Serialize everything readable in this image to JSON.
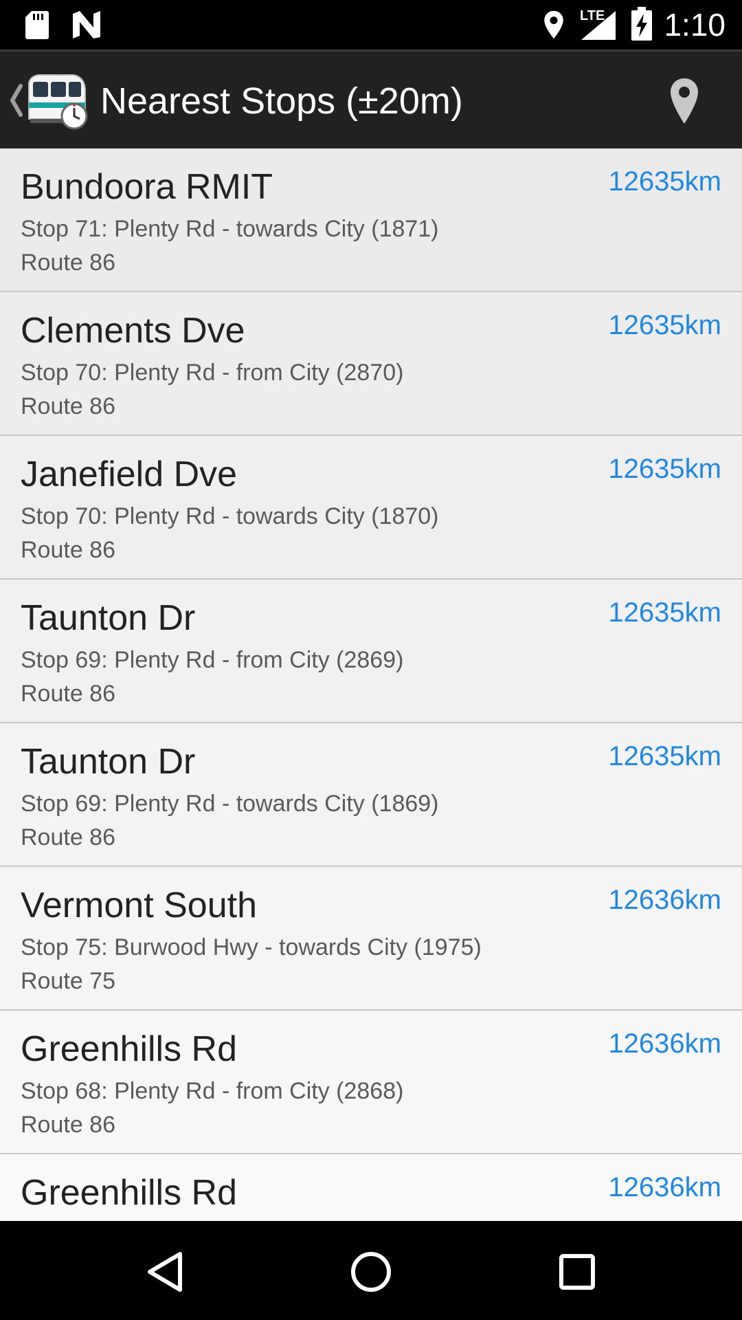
{
  "status_bar": {
    "time": "1:10",
    "network_type": "LTE",
    "icons": [
      "sd-card-icon",
      "n-logo-icon",
      "location-pin-icon",
      "signal-icon",
      "battery-charging-icon"
    ]
  },
  "action_bar": {
    "title": "Nearest Stops (±20m)",
    "icons": [
      "back-chevron-icon",
      "tram-clock-app-icon",
      "location-pin-icon"
    ]
  },
  "stops": [
    {
      "name": "Bundoora RMIT",
      "description": "Stop 71: Plenty Rd - towards City (1871)",
      "route": "Route 86",
      "distance": "12635km"
    },
    {
      "name": "Clements Dve",
      "description": "Stop 70: Plenty Rd - from City (2870)",
      "route": "Route 86",
      "distance": "12635km"
    },
    {
      "name": "Janefield Dve",
      "description": "Stop 70: Plenty Rd - towards City (1870)",
      "route": "Route 86",
      "distance": "12635km"
    },
    {
      "name": "Taunton Dr",
      "description": "Stop 69: Plenty Rd - from City (2869)",
      "route": "Route 86",
      "distance": "12635km"
    },
    {
      "name": "Taunton Dr",
      "description": "Stop 69: Plenty Rd - towards City (1869)",
      "route": "Route 86",
      "distance": "12635km"
    },
    {
      "name": "Vermont South",
      "description": "Stop 75: Burwood Hwy - towards City (1975)",
      "route": "Route 75",
      "distance": "12636km"
    },
    {
      "name": "Greenhills Rd",
      "description": "Stop 68: Plenty Rd - from City (2868)",
      "route": "Route 86",
      "distance": "12636km"
    },
    {
      "name": "Greenhills Rd",
      "description": "",
      "route": "",
      "distance": "12636km"
    }
  ],
  "nav_bar": {
    "icons": [
      "back-triangle-icon",
      "home-circle-icon",
      "recents-square-icon"
    ]
  },
  "colors": {
    "status_bar_bg": "#000000",
    "action_bar_bg": "#212121",
    "list_bg": "#f2f2f2",
    "distance_text": "#1e88e5",
    "nav_bar_bg": "#000000"
  }
}
